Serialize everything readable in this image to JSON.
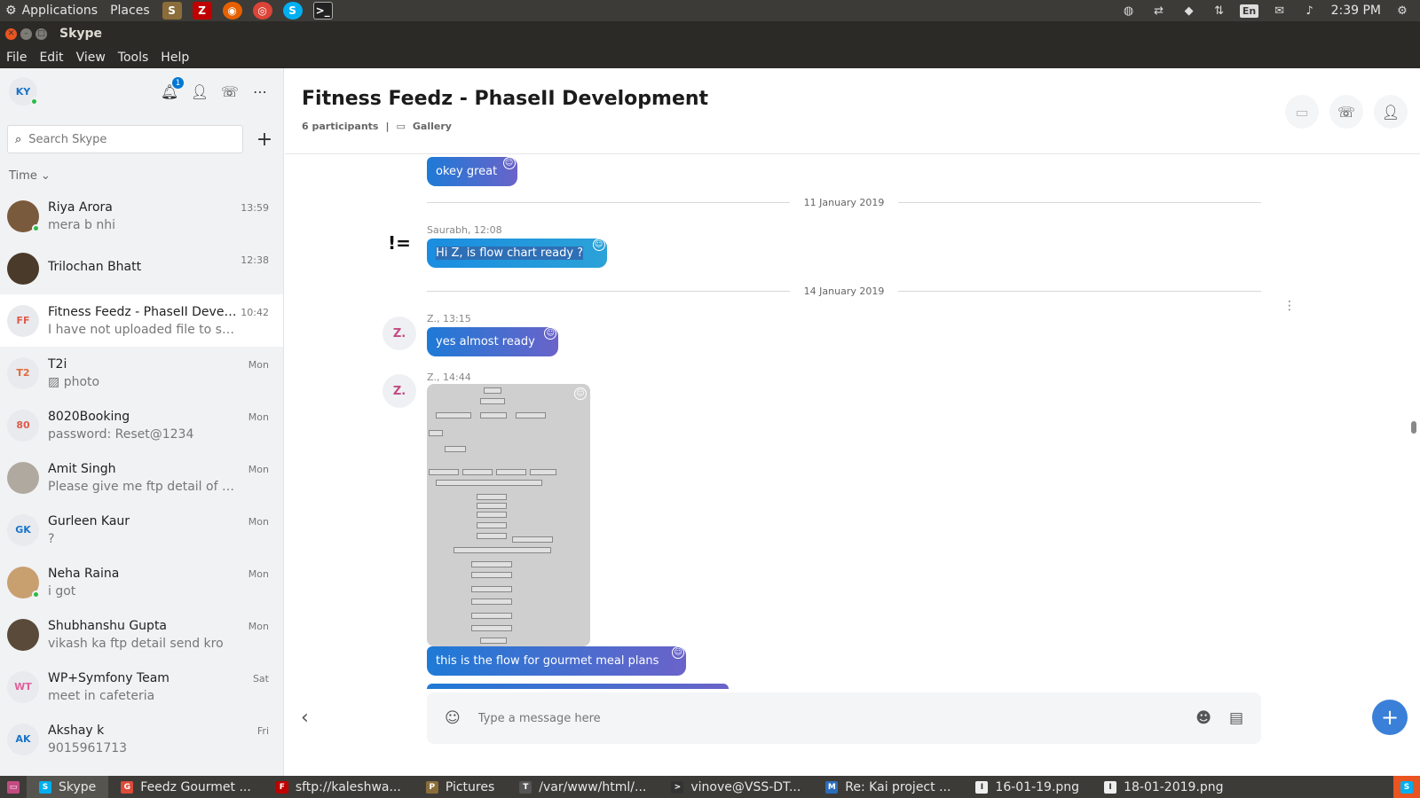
{
  "system_panel": {
    "applications": "Applications",
    "places": "Places",
    "time": "2:39 PM",
    "lang": "En"
  },
  "window": {
    "title": "Skype"
  },
  "menu": [
    "File",
    "Edit",
    "View",
    "Tools",
    "Help"
  ],
  "sidebar": {
    "me_initials": "KY",
    "notification_count": "1",
    "search_placeholder": "Search Skype",
    "sort_label": "Time",
    "chats": [
      {
        "name": "Riya Arora",
        "preview": "mera b nhi",
        "time": "13:59",
        "avatar": "",
        "avatar_color": "#7a5a3c",
        "online": true
      },
      {
        "name": "Trilochan Bhatt",
        "preview": "",
        "time": "12:38",
        "avatar": "",
        "avatar_color": "#4a3a2a",
        "online": false
      },
      {
        "name": "Fitness Feedz - PhaseII Develo...",
        "preview": "I have not uploaded file to serve...",
        "time": "10:42",
        "avatar": "FF",
        "avatar_color": "#e05a4a",
        "online": false
      },
      {
        "name": "T2i",
        "preview": "photo",
        "time": "Mon",
        "avatar": "T2",
        "avatar_color": "#e06a3a",
        "online": false
      },
      {
        "name": "8020Booking",
        "preview": "password: Reset@1234",
        "time": "Mon",
        "avatar": "80",
        "avatar_color": "#e05a4a",
        "online": false
      },
      {
        "name": "Amit Singh",
        "preview": "Please give me ftp detail of this ...",
        "time": "Mon",
        "avatar": "",
        "avatar_color": "#b0a9a0",
        "online": false
      },
      {
        "name": "Gurleen Kaur",
        "preview": "?",
        "time": "Mon",
        "avatar": "GK",
        "avatar_color": "#1a74c8",
        "online": false
      },
      {
        "name": "Neha Raina",
        "preview": "i got",
        "time": "Mon",
        "avatar": "",
        "avatar_color": "#c8a070",
        "online": true
      },
      {
        "name": "Shubhanshu Gupta",
        "preview": "vikash ka ftp detail send kro",
        "time": "Mon",
        "avatar": "",
        "avatar_color": "#5a4a3a",
        "online": false
      },
      {
        "name": "WP+Symfony Team",
        "preview": "meet in  cafeteria",
        "time": "Sat",
        "avatar": "WT",
        "avatar_color": "#e0609a",
        "online": false
      },
      {
        "name": "Akshay k",
        "preview": "9015961713",
        "time": "Fri",
        "avatar": "AK",
        "avatar_color": "#1a74c8",
        "online": false
      }
    ]
  },
  "conversation": {
    "title": "Fitness Feedz - PhaseII Development",
    "participants": "6 participants",
    "gallery": "Gallery",
    "messages": {
      "m1": "okey great",
      "date1": "11 January 2019",
      "meta2": "Saurabh, 12:08",
      "m2": "Hi Z, is flow chart ready ?",
      "avatar2": "!=",
      "date2": "14 January 2019",
      "meta3": "Z., 13:15",
      "avatar3": "Z.",
      "m3": "yes almost ready",
      "meta4": "Z., 14:44",
      "avatar4": "Z.",
      "m5": "this is the flow for gourmet meal plans"
    },
    "composer_placeholder": "Type a message here"
  },
  "taskbar": [
    {
      "label": "Skype",
      "icon": "S",
      "color": "#00aff0",
      "active": true
    },
    {
      "label": "Feedz Gourmet ...",
      "icon": "G",
      "color": "#dd4b39",
      "active": false
    },
    {
      "label": "sftp://kaleshwa...",
      "icon": "F",
      "color": "#bf0000",
      "active": false
    },
    {
      "label": "Pictures",
      "icon": "P",
      "color": "#8a6d3b",
      "active": false
    },
    {
      "label": "/var/www/html/...",
      "icon": "T",
      "color": "#555",
      "active": false
    },
    {
      "label": "vinove@VSS-DT...",
      "icon": ">",
      "color": "#333",
      "active": false
    },
    {
      "label": "Re: Kai project ...",
      "icon": "M",
      "color": "#2a6ebb",
      "active": false
    },
    {
      "label": "16-01-19.png",
      "icon": "I",
      "color": "#eee",
      "active": false
    },
    {
      "label": "18-01-2019.png",
      "icon": "I",
      "color": "#eee",
      "active": false
    }
  ]
}
